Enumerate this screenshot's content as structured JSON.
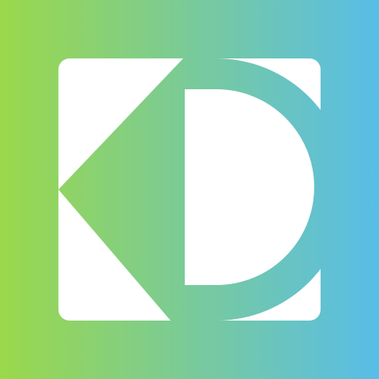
{
  "icon": {
    "logo_name": "app-logo-icon",
    "colors": {
      "gradient_start": "#9bd84a",
      "gradient_end": "#58bde8",
      "tile": "#ffffff"
    }
  }
}
